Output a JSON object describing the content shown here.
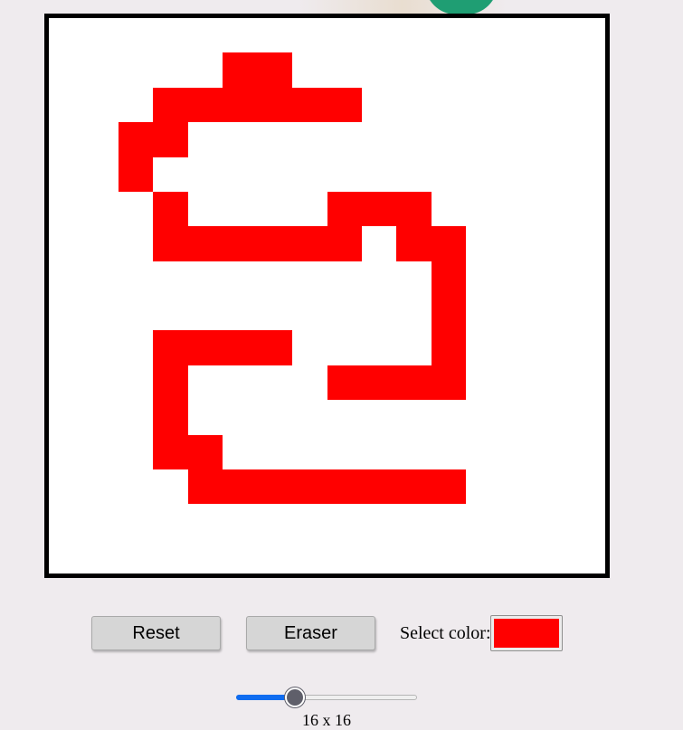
{
  "canvas": {
    "grid_size": 16,
    "paint_color": "#ff0000",
    "background_color": "#ffffff",
    "painted_cells": [
      [
        1,
        5
      ],
      [
        1,
        6
      ],
      [
        2,
        3
      ],
      [
        2,
        4
      ],
      [
        2,
        5
      ],
      [
        2,
        6
      ],
      [
        2,
        7
      ],
      [
        2,
        8
      ],
      [
        3,
        2
      ],
      [
        3,
        3
      ],
      [
        4,
        2
      ],
      [
        5,
        3
      ],
      [
        5,
        8
      ],
      [
        5,
        9
      ],
      [
        5,
        10
      ],
      [
        6,
        3
      ],
      [
        6,
        4
      ],
      [
        6,
        5
      ],
      [
        6,
        6
      ],
      [
        6,
        7
      ],
      [
        6,
        8
      ],
      [
        6,
        10
      ],
      [
        6,
        11
      ],
      [
        7,
        11
      ],
      [
        8,
        11
      ],
      [
        9,
        3
      ],
      [
        9,
        4
      ],
      [
        9,
        5
      ],
      [
        9,
        6
      ],
      [
        9,
        11
      ],
      [
        10,
        3
      ],
      [
        10,
        8
      ],
      [
        10,
        9
      ],
      [
        10,
        10
      ],
      [
        10,
        11
      ],
      [
        11,
        3
      ],
      [
        12,
        3
      ],
      [
        12,
        4
      ],
      [
        13,
        4
      ],
      [
        13,
        5
      ],
      [
        13,
        6
      ],
      [
        13,
        7
      ],
      [
        13,
        8
      ],
      [
        13,
        9
      ],
      [
        13,
        10
      ],
      [
        13,
        11
      ]
    ]
  },
  "controls": {
    "reset_label": "Reset",
    "eraser_label": "Eraser",
    "color_label": "Select color:",
    "selected_color": "#ff0000"
  },
  "slider": {
    "value": 16,
    "min": 1,
    "max": 64
  },
  "grid_size_label": "16 x 16"
}
